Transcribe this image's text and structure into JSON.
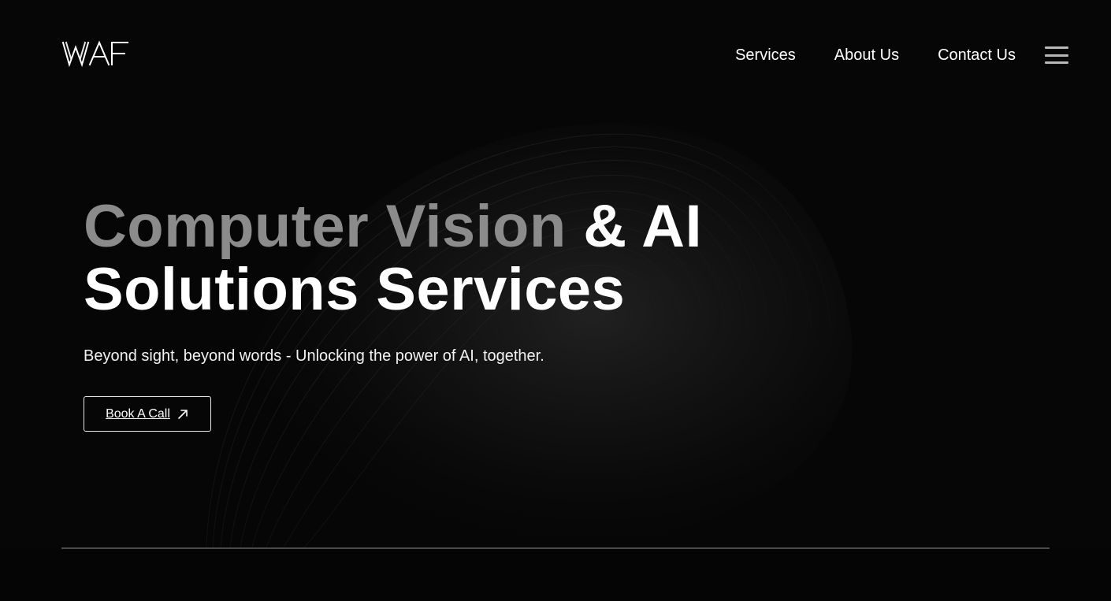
{
  "brand": {
    "name": "WAF",
    "logo_icon": "waf-logo"
  },
  "nav": {
    "items": [
      "Services",
      "About Us",
      "Contact Us"
    ],
    "menu_icon": "hamburger-menu-icon"
  },
  "hero": {
    "title_line1_muted": "Computer Vision",
    "title_line1_accent": "& AI",
    "title_line2": "Solutions Services",
    "subtitle": "Beyond sight, beyond words - Unlocking the power of AI, together.",
    "cta_label": "Book A Call",
    "cta_icon": "arrow-up-right-icon"
  },
  "colors": {
    "background": "#050505",
    "title_muted": "#8b8b8b",
    "title_white": "#ffffff",
    "text": "#ffffff",
    "menu_icon": "#b8b8b8"
  }
}
